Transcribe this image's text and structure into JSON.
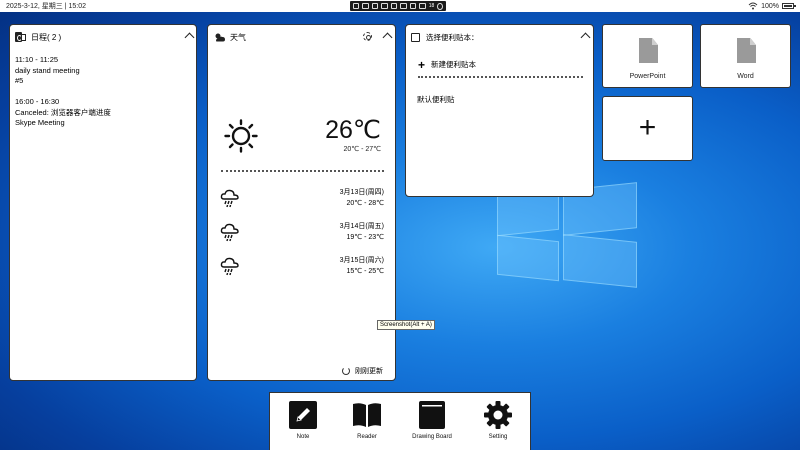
{
  "statusbar": {
    "datetime": "2025-3-12, 星期三 | 15:02",
    "tray_badge": "18",
    "battery": "100%"
  },
  "calendar": {
    "title": "日程( 2 )",
    "events": [
      {
        "time": "11:10 - 11:25",
        "line1": "daily stand meeting",
        "line2": "#5"
      },
      {
        "time": "16:00 - 16:30",
        "line1": "Canceled: 浏览器客户端进度",
        "line2": "Skype Meeting"
      }
    ]
  },
  "weather": {
    "title": "天气",
    "current_icon": "sun-icon",
    "temperature": "26℃",
    "range": "20℃ - 27℃",
    "forecast": [
      {
        "date": "3月13日(周四)",
        "range": "20℃ - 28℃",
        "icon": "rain-cloud-icon"
      },
      {
        "date": "3月14日(周五)",
        "range": "19℃ - 23℃",
        "icon": "rain-cloud-icon"
      },
      {
        "date": "3月15日(周六)",
        "range": "15℃ - 25℃",
        "icon": "rain-cloud-icon"
      }
    ],
    "refresh_label": "刚刚更新"
  },
  "notes": {
    "title": "选择便利贴本：",
    "new_label": "新建便利贴本",
    "default_label": "默认便利贴"
  },
  "tiles": {
    "ppt": "PowerPoint",
    "word": "Word",
    "add": "+"
  },
  "tooltip": "Screenshot(Alt + A)",
  "dock": {
    "note": "Note",
    "reader": "Reader",
    "drawing": "Drawing Board",
    "setting": "Setting"
  },
  "colors": {
    "desktop_blue": "#0a5fc8",
    "card_border": "#333333"
  }
}
